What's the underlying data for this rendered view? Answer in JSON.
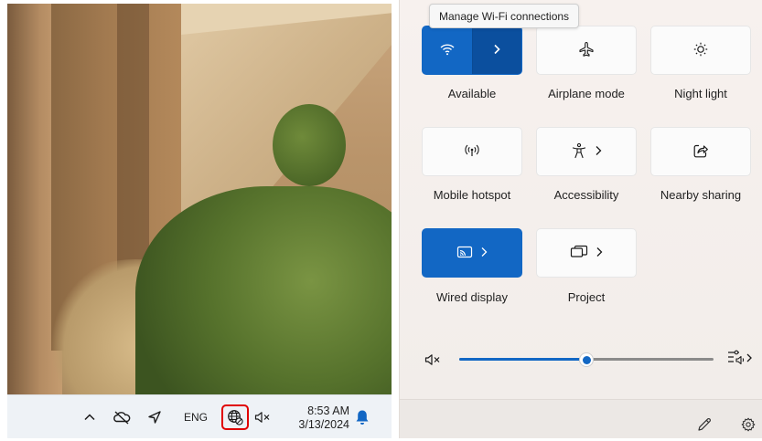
{
  "taskbar": {
    "language": "ENG",
    "time": "8:53 AM",
    "date": "3/13/2024"
  },
  "tooltip": {
    "text": "Manage Wi-Fi connections"
  },
  "quick_settings": {
    "tiles": [
      {
        "id": "wifi",
        "label": "Available",
        "active": true,
        "icon": "wifi-icon",
        "expandable": true
      },
      {
        "id": "airplane",
        "label": "Airplane mode",
        "active": false,
        "icon": "airplane-icon"
      },
      {
        "id": "night",
        "label": "Night light",
        "active": false,
        "icon": "brightness-icon"
      },
      {
        "id": "hotspot",
        "label": "Mobile hotspot",
        "active": false,
        "icon": "hotspot-icon"
      },
      {
        "id": "accessibility",
        "label": "Accessibility",
        "active": false,
        "icon": "accessibility-icon",
        "expandable": true
      },
      {
        "id": "nearby",
        "label": "Nearby sharing",
        "active": false,
        "icon": "share-icon"
      },
      {
        "id": "wired",
        "label": "Wired display",
        "active": true,
        "icon": "cast-icon",
        "expandable": true
      },
      {
        "id": "project",
        "label": "Project",
        "active": false,
        "icon": "project-icon",
        "expandable": true
      }
    ],
    "volume_percent": 50,
    "muted": true
  },
  "colors": {
    "accent": "#1267c4",
    "accent_dark": "#0b4f9e",
    "highlight": "#e00000"
  }
}
